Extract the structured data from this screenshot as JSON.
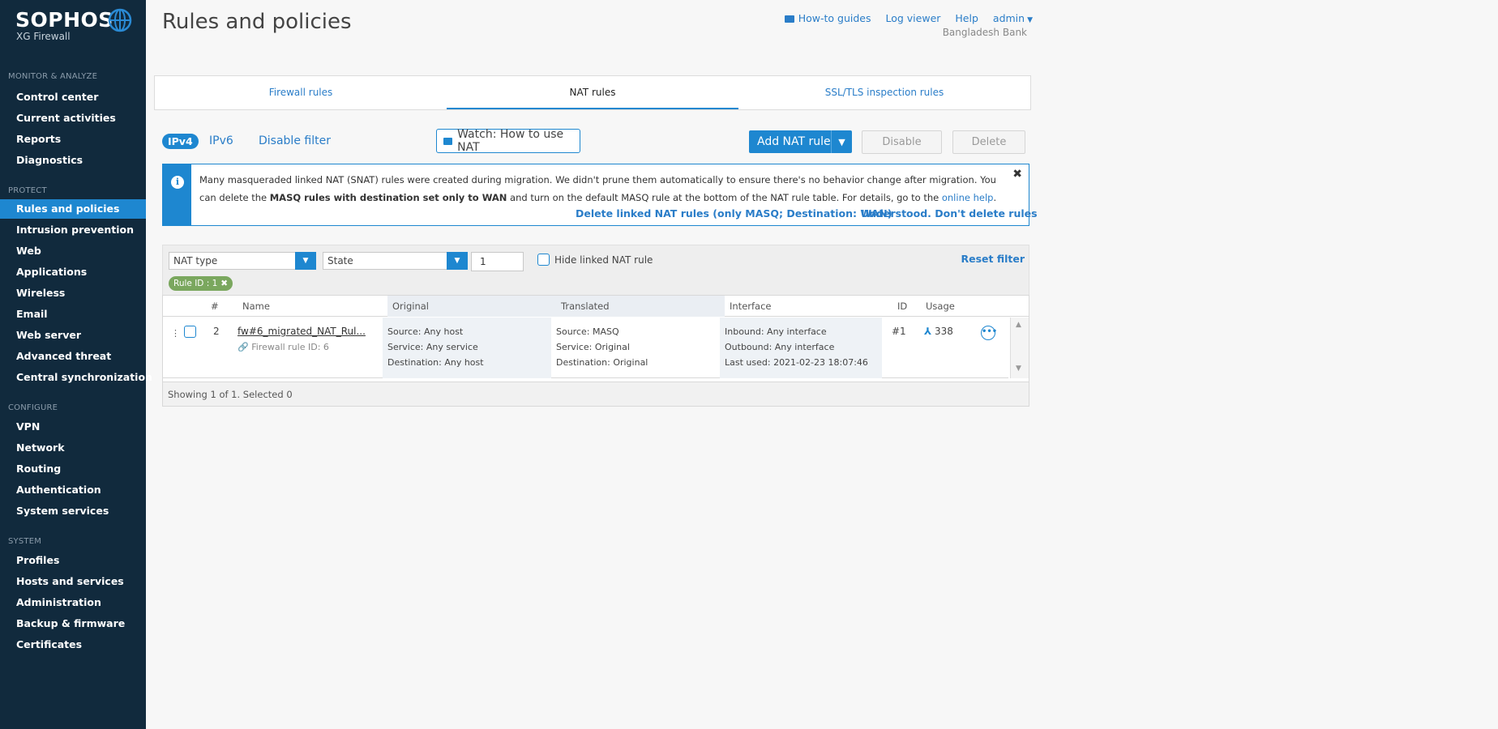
{
  "brand": {
    "name": "SOPHOS",
    "product": "XG Firewall"
  },
  "sidebar": {
    "sections": [
      {
        "title": "MONITOR & ANALYZE",
        "items": [
          "Control center",
          "Current activities",
          "Reports",
          "Diagnostics"
        ]
      },
      {
        "title": "PROTECT",
        "items": [
          "Rules and policies",
          "Intrusion prevention",
          "Web",
          "Applications",
          "Wireless",
          "Email",
          "Web server",
          "Advanced threat",
          "Central synchronization"
        ]
      },
      {
        "title": "CONFIGURE",
        "items": [
          "VPN",
          "Network",
          "Routing",
          "Authentication",
          "System services"
        ]
      },
      {
        "title": "SYSTEM",
        "items": [
          "Profiles",
          "Hosts and services",
          "Administration",
          "Backup & firmware",
          "Certificates"
        ]
      }
    ],
    "active": "Rules and policies"
  },
  "header": {
    "title": "Rules and policies",
    "links": {
      "howto": "How-to guides",
      "logviewer": "Log viewer",
      "help": "Help",
      "user": "admin"
    },
    "org": "Bangladesh Bank"
  },
  "tabs": [
    "Firewall rules",
    "NAT rules",
    "SSL/TLS inspection rules"
  ],
  "active_tab": "NAT rules",
  "toolbar": {
    "ipv4": "IPv4",
    "ipv6": "IPv6",
    "disable_filter": "Disable filter",
    "watch": "Watch: How to use NAT",
    "add": "Add NAT rule",
    "disable": "Disable",
    "delete": "Delete"
  },
  "info": {
    "text1": "Many masqueraded linked NAT (SNAT) rules were created during migration. We didn't prune them automatically to ensure there's no behavior change after migration. You can delete the ",
    "bold": "MASQ rules with destination set only to WAN",
    "text2": " and turn on the default MASQ rule at the bottom of the NAT rule table. For details, go to the ",
    "link": "online help",
    "text3": ".",
    "action1": "Delete linked NAT rules (only MASQ; Destination: WAN)",
    "action2": "Understood. Don't delete rules"
  },
  "filters": {
    "nat_type": "NAT type",
    "state": "State",
    "rule_value": "1",
    "hide_linked": "Hide linked NAT rule",
    "reset": "Reset filter",
    "chip": "Rule ID : 1"
  },
  "table": {
    "headers": {
      "num": "#",
      "name": "Name",
      "original": "Original",
      "translated": "Translated",
      "interface": "Interface",
      "id": "ID",
      "usage": "Usage"
    },
    "row": {
      "num": "2",
      "name": "fw#6_migrated_NAT_Rul...",
      "fwlink": "Firewall rule ID: 6",
      "original": [
        "Source: Any host",
        "Service: Any service",
        "Destination: Any host"
      ],
      "translated": [
        "Source: MASQ",
        "Service: Original",
        "Destination: Original"
      ],
      "interface": [
        "Inbound: Any interface",
        "Outbound: Any interface",
        "Last used: 2021-02-23 18:07:46"
      ],
      "id": "#1",
      "usage": "338"
    },
    "footer": "Showing 1 of 1. Selected 0"
  }
}
